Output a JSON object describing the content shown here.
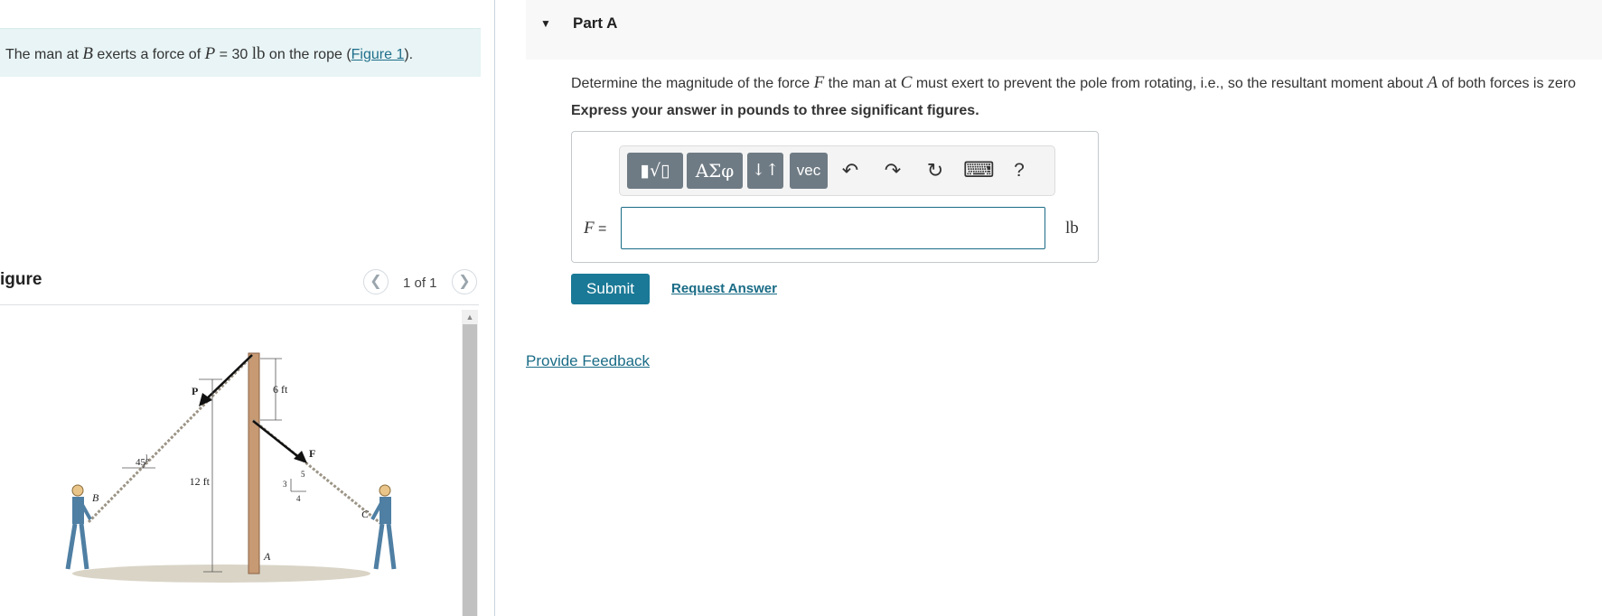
{
  "problem": {
    "statement_pre": "The man at ",
    "point_b": "B",
    "statement_mid": " exerts a force of ",
    "symbol_p": "P",
    "statement_eq": " = 30 ",
    "unit_lb": "lb",
    "statement_post": " on the rope (",
    "figure_link": "Figure 1",
    "statement_end": ")."
  },
  "figure_panel": {
    "title": "igure",
    "pager_text": "1 of 1",
    "labels": {
      "p": "P",
      "f": "F",
      "b": "B",
      "c": "C",
      "a": "A",
      "six_ft": "6 ft",
      "twelve_ft": "12 ft",
      "angle": "45°",
      "slope_3": "3",
      "slope_4": "4",
      "slope_5": "5"
    }
  },
  "part": {
    "title": "Part A",
    "question_1": "Determine the magnitude of the force ",
    "symbol_f": "F",
    "question_2": " the man at ",
    "symbol_c": "C",
    "question_3": " must exert to prevent the pole from rotating, i.e., so the resultant moment about ",
    "symbol_a": "A",
    "question_4": " of both forces is zero",
    "instruction": "Express your answer in pounds to three significant figures."
  },
  "toolbar": {
    "templates": "▮√▯",
    "greek": "ΑΣφ",
    "arrows": "↓↑",
    "vec": "vec",
    "undo": "↶",
    "redo": "↷",
    "reset": "↻",
    "keyboard": "⌨",
    "help": "?"
  },
  "answer": {
    "var": "F",
    "equals": " =",
    "value": "",
    "unit": "lb"
  },
  "actions": {
    "submit": "Submit",
    "request": "Request Answer",
    "feedback": "Provide Feedback"
  },
  "colors": {
    "accent": "#1a7996",
    "statement_bg": "#e8f4f5",
    "toolbar_btn": "#6f7b84"
  }
}
